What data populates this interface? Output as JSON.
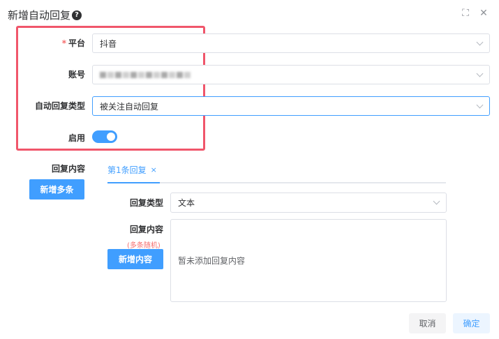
{
  "dialog": {
    "title": "新增自动回复",
    "help_icon": "?",
    "fullscreen_icon": "⛶",
    "close_icon": "✕"
  },
  "form": {
    "platform": {
      "label": "平台",
      "required_mark": "*",
      "value": "抖音"
    },
    "account": {
      "label": "账号",
      "value_blurred": true
    },
    "reply_type": {
      "label": "自动回复类型",
      "value": "被关注自动回复"
    },
    "enabled": {
      "label": "启用",
      "on": true
    }
  },
  "reply_section": {
    "label": "回复内容",
    "add_multiple_button": "新增多条",
    "tabs": [
      {
        "label": "第1条回复",
        "close_icon": "×"
      }
    ],
    "content_type": {
      "label": "回复类型",
      "value": "文本"
    },
    "content": {
      "label": "回复内容",
      "note": "(多条随机)",
      "add_button": "新增内容",
      "empty_text": "暂未添加回复内容"
    }
  },
  "footer": {
    "cancel": "取消",
    "confirm": "确定"
  },
  "colors": {
    "primary": "#409eff",
    "highlight": "#f0566b",
    "danger": "#f56c6c"
  }
}
